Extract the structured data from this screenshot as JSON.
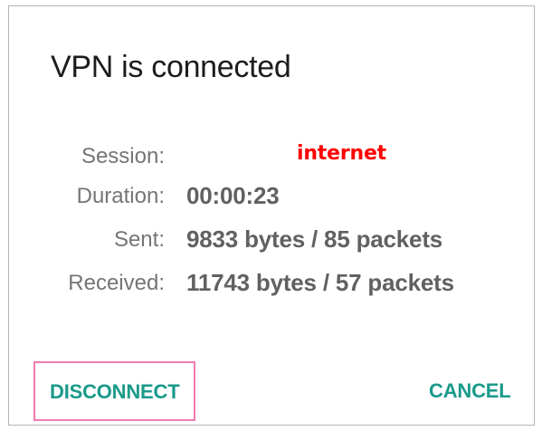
{
  "dialog": {
    "title": "VPN is connected",
    "fields": [
      {
        "label": "Session:",
        "value": "internet"
      },
      {
        "label": "Duration:",
        "value": "00:00:23"
      },
      {
        "label": "Sent:",
        "value": "9833 bytes / 85 packets"
      },
      {
        "label": "Received:",
        "value": "11743 bytes / 57 packets"
      }
    ],
    "buttons": {
      "disconnect": "DISCONNECT",
      "cancel": "CANCEL"
    }
  },
  "colors": {
    "title": "#1c1c1c",
    "label": "#757575",
    "value": "#616161",
    "session_value": "#ff0000",
    "button_text": "#1a9a8a",
    "highlight_border": "#f37ab1"
  }
}
